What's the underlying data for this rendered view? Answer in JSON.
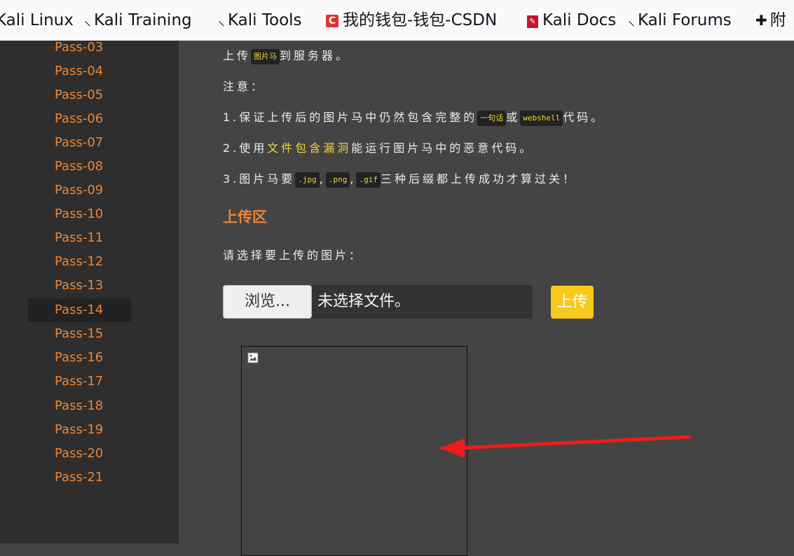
{
  "bookmarks": [
    {
      "label": "Kali Linux",
      "icon": "kali-dragon-icon"
    },
    {
      "label": "Kali Training",
      "icon": "kali-dragon-icon"
    },
    {
      "label": "Kali Tools",
      "icon": "kali-dragon-icon"
    },
    {
      "label": "我的钱包-钱包-CSDN",
      "icon": "csdn-icon",
      "icon_glyph": "C"
    },
    {
      "label": "Kali Docs",
      "icon": "kali-docs-icon"
    },
    {
      "label": "Kali Forums",
      "icon": "kali-dragon-icon"
    },
    {
      "label": "附",
      "icon": "puzzle-icon"
    }
  ],
  "sidebar": {
    "items": [
      "Pass-03",
      "Pass-04",
      "Pass-05",
      "Pass-06",
      "Pass-07",
      "Pass-08",
      "Pass-09",
      "Pass-10",
      "Pass-11",
      "Pass-12",
      "Pass-13",
      "Pass-14",
      "Pass-15",
      "Pass-16",
      "Pass-17",
      "Pass-18",
      "Pass-19",
      "Pass-20",
      "Pass-21"
    ],
    "active": "Pass-14"
  },
  "task": {
    "line1": {
      "pre": "上传",
      "code": "图片马",
      "post": "到服务器。"
    },
    "note": "注意：",
    "line2": {
      "pre": "1.保证上传后的图片马中仍然包含完整的",
      "code1": "一句话",
      "mid": "或",
      "code2": "webshell",
      "post": "代码。"
    },
    "line3": {
      "pre": "2.使用",
      "hl": "文件包含漏洞",
      "post": "能运行图片马中的恶意代码。"
    },
    "line4": {
      "pre": "3.图片马要",
      "code1": ".jpg",
      "sep1": ",",
      "code2": ".png",
      "sep2": ",",
      "code3": ".gif",
      "post": "三种后缀都上传成功才算过关！"
    }
  },
  "upload": {
    "section_title": "上传区",
    "prompt": "请选择要上传的图片：",
    "browse_label": "浏览...",
    "no_file_label": "未选择文件。",
    "submit_label": "上传"
  },
  "colors": {
    "accent_orange": "#ee8430",
    "code_yellow": "#f5d33a",
    "button_yellow": "#f8c91c",
    "annotation_red": "#ee1c1c"
  }
}
